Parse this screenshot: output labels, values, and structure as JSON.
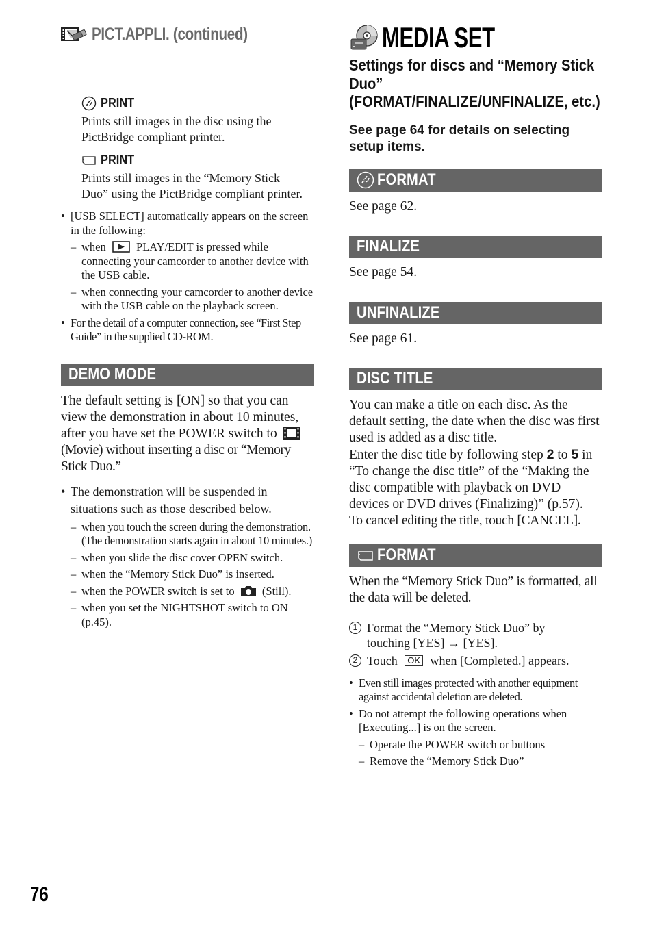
{
  "page_number": "76",
  "left_column": {
    "continued_header": {
      "icon": "pict-appli-icon",
      "title": "PICT.APPLI. (continued)"
    },
    "print_items": [
      {
        "icon": "disc-icon",
        "label": "PRINT",
        "text": "Prints still images in the disc using the PictBridge compliant printer."
      },
      {
        "icon": "memory-stick-icon",
        "label": "PRINT",
        "text": "Prints still images in the “Memory Stick Duo” using the PictBridge compliant printer."
      }
    ],
    "notes": [
      {
        "text": "[USB SELECT] automatically appears on the screen in the following:",
        "sub": [
          {
            "before": "when",
            "icon": "play-edit-icon",
            "after": "PLAY/EDIT is pressed while connecting your camcorder to another device with the USB cable."
          },
          {
            "text": "when connecting your camcorder to another device with the USB cable on the playback screen."
          }
        ]
      },
      {
        "text": "For the detail of a computer connection, see “First Step Guide” in the supplied CD-ROM."
      }
    ],
    "demo_mode": {
      "heading": "DEMO MODE",
      "body_before_icon": "The default setting is [ON] so that you can view the demonstration in about 10 minutes, after you have set the POWER switch to",
      "body_icon": "movie-icon",
      "body_after_icon": "(Movie) without inserting a disc or “Memory Stick Duo.”",
      "bullet": "The demonstration will be suspended in situations such as those described below.",
      "situations": [
        {
          "text": "when you touch the screen during the demonstration. (The demonstration starts again in about 10 minutes.)"
        },
        {
          "text": "when you slide the disc cover OPEN switch."
        },
        {
          "text": "when the “Memory Stick Duo” is inserted."
        },
        {
          "before": "when the POWER switch is set to",
          "icon": "camera-icon",
          "after": "(Still)."
        },
        {
          "text": "when you set the NIGHTSHOT switch to ON (p.45)."
        }
      ]
    }
  },
  "right_column": {
    "main_header": {
      "icon": "media-set-icon",
      "title": "MEDIA SET"
    },
    "subtitle": "Settings for discs and “Memory Stick Duo” (FORMAT/FINALIZE/UNFINALIZE, etc.)",
    "subtitle_lines": [
      "Settings for discs and “Memory Stick",
      "Duo”",
      "(FORMAT/FINALIZE/UNFINALIZE, etc.)"
    ],
    "see_page_note": "See page 64 for details on selecting setup items.",
    "sections": {
      "format_disc": {
        "icon": "disc-icon",
        "heading": "FORMAT",
        "body": "See page 62."
      },
      "finalize": {
        "heading": "FINALIZE",
        "body": "See page 54."
      },
      "unfinalize": {
        "heading": "UNFINALIZE",
        "body": "See page 61."
      },
      "disc_title": {
        "heading": "DISC TITLE",
        "para1": "You can make a title on each disc. As the default setting, the date when the disc was first used is added as a disc title.",
        "para2_before": "Enter the disc title by following step",
        "step_from": "2",
        "para2_mid": "to",
        "step_to": "5",
        "para2_after": "in “To change the disc title” of the “Making the disc compatible with playback on DVD devices or DVD drives (Finalizing)” (p.57).",
        "para3": "To cancel editing the title, touch [CANCEL]."
      },
      "format_memory_stick": {
        "icon": "memory-stick-icon",
        "heading": "FORMAT",
        "intro": "When the “Memory Stick Duo” is formatted, all the data will be deleted.",
        "steps": [
          {
            "num": "1",
            "text": "Format the “Memory Stick Duo” by touching [YES] → [YES]."
          },
          {
            "num": "2",
            "before": "Touch",
            "button": "OK",
            "after": "when [Completed.] appears."
          }
        ],
        "notes": [
          {
            "text": "Even still images protected with another equipment against accidental deletion are deleted."
          },
          {
            "text": "Do not attempt the following operations when [Executing...] is on the screen.",
            "sub": [
              "Operate the POWER switch or buttons",
              "Remove the “Memory Stick Duo”"
            ]
          }
        ]
      }
    }
  },
  "colors": {
    "section_bar": "#656565",
    "continued_title": "#6a6a6a",
    "text": "#1a1a1a"
  }
}
